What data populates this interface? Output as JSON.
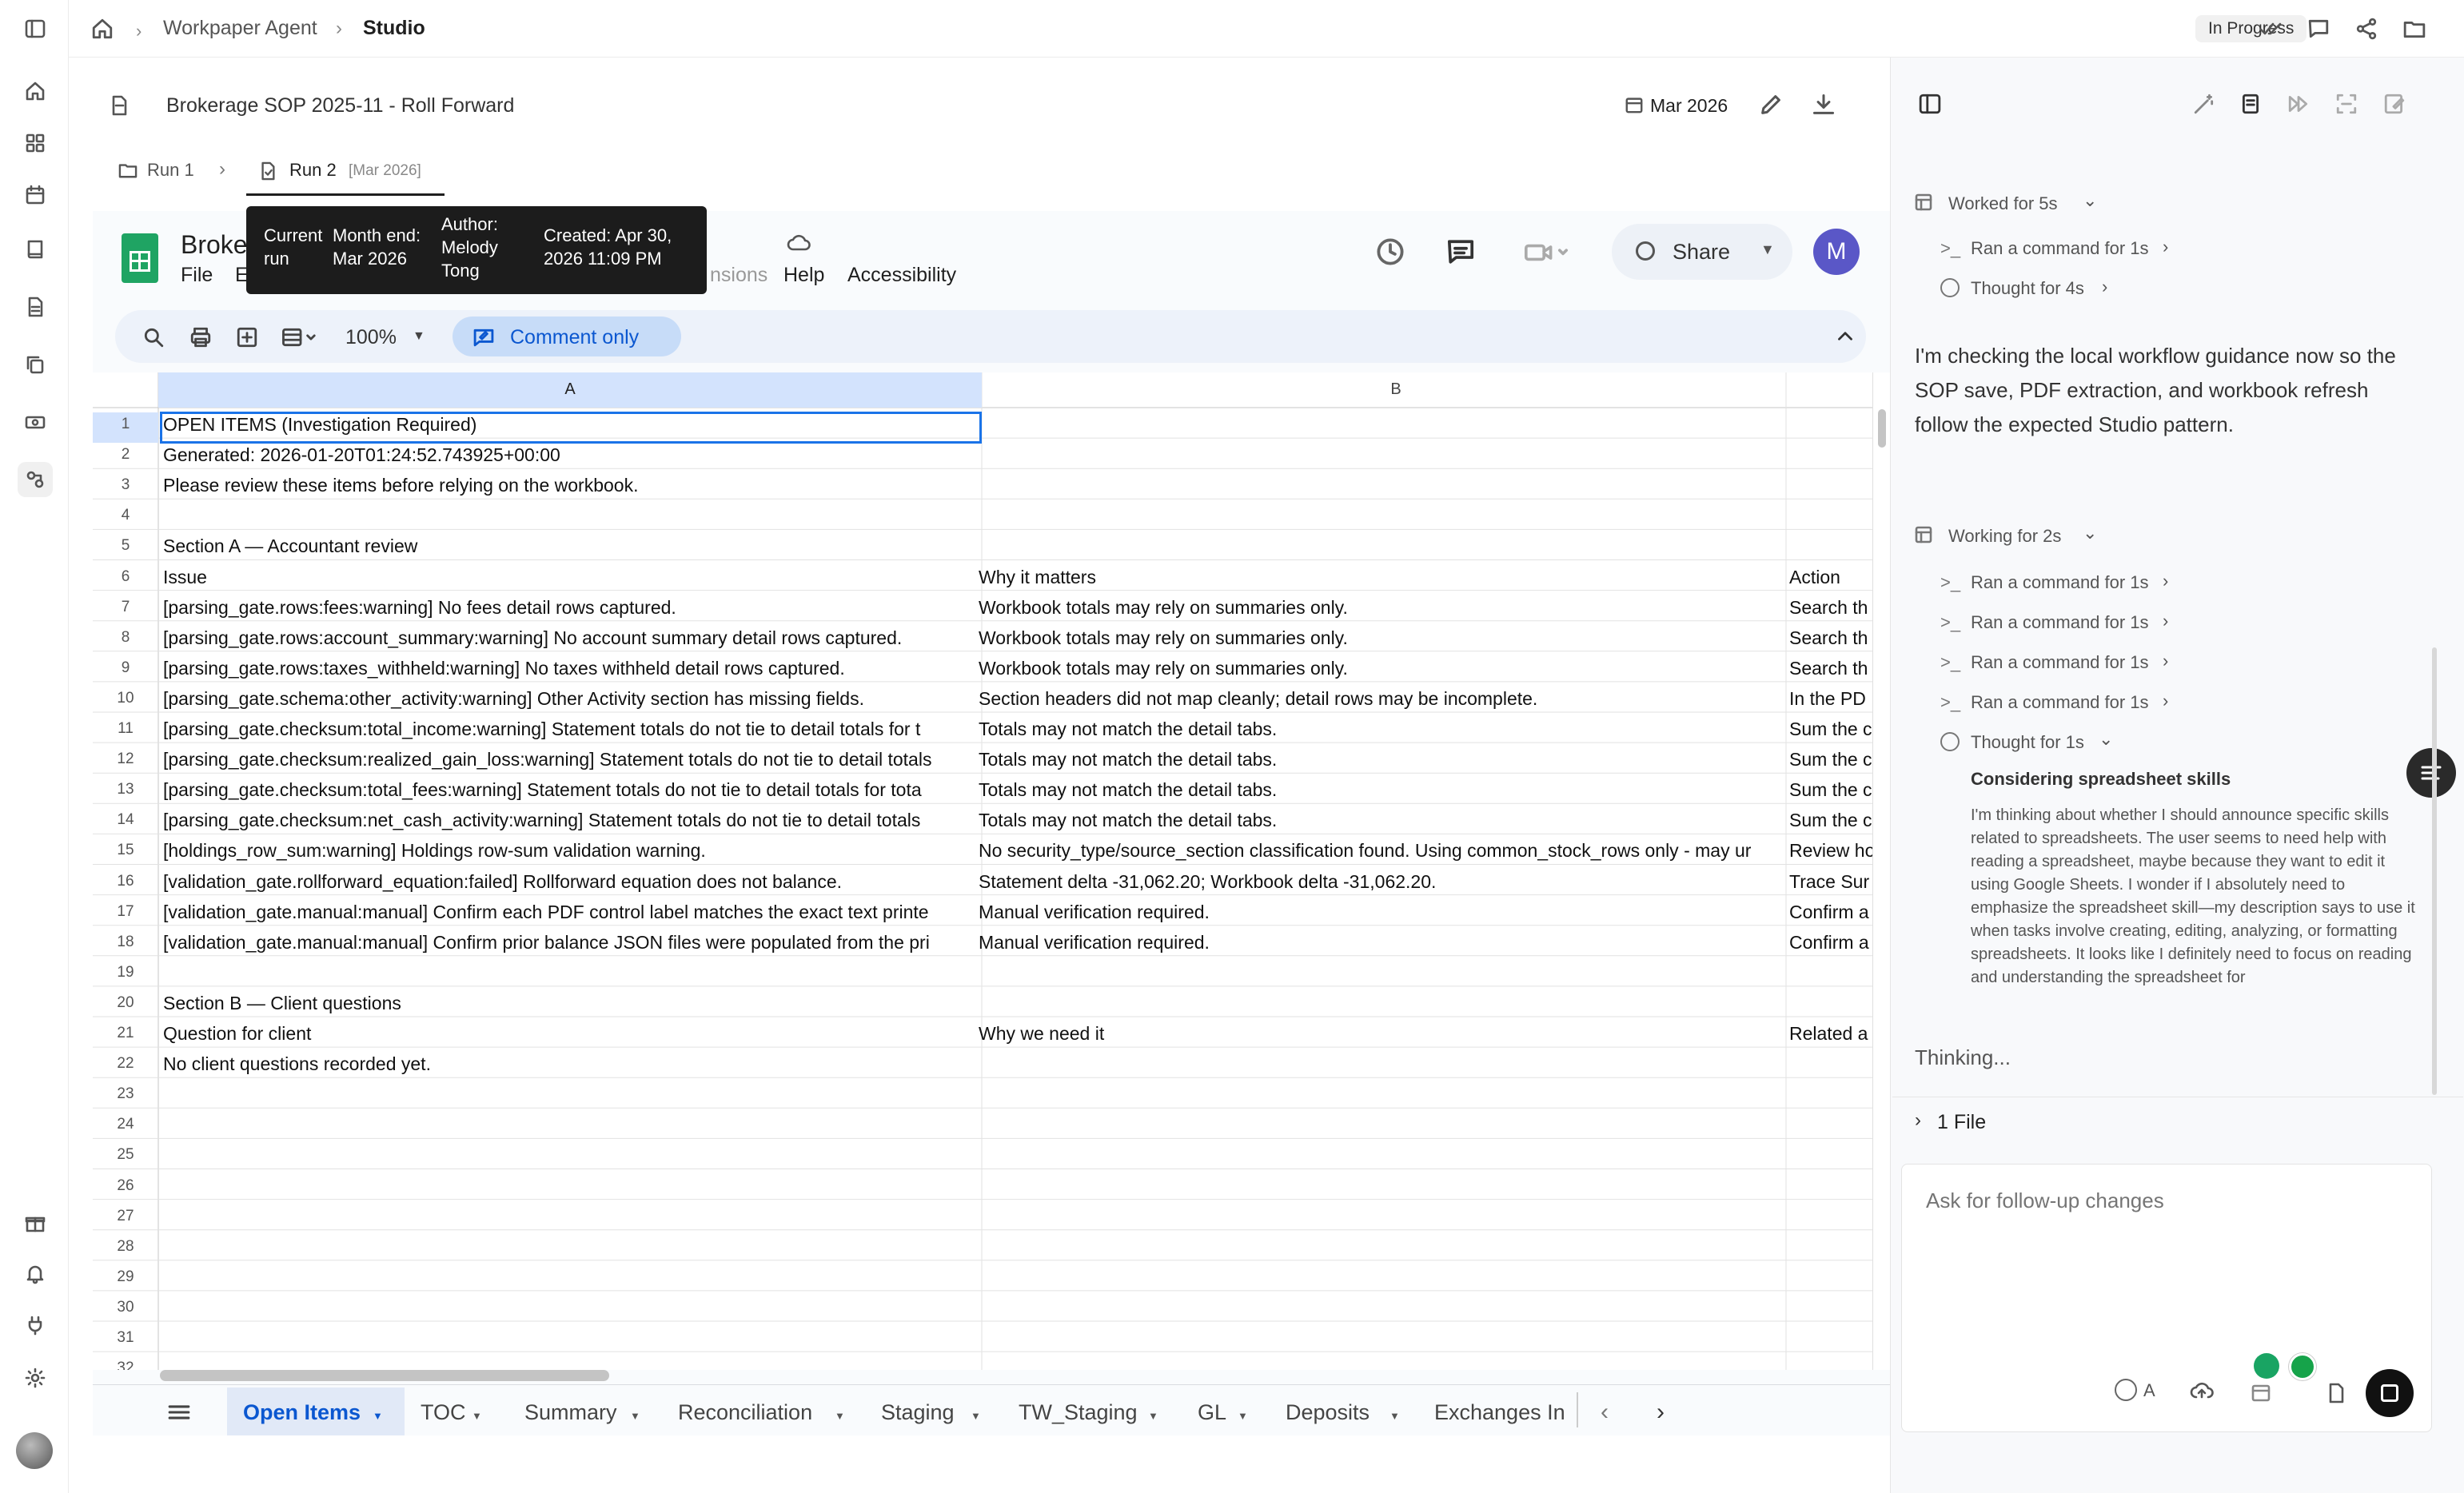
{
  "breadcrumb": {
    "agent": "Workpaper Agent",
    "current": "Studio"
  },
  "status_badge": "In Progress",
  "doc": {
    "title": "Brokerage SOP 2025-11 - Roll Forward",
    "date": "Mar 2026"
  },
  "runs": [
    {
      "label": "Run 1"
    },
    {
      "label": "Run 2",
      "tag": "[Mar 2026]"
    }
  ],
  "tooltip": {
    "c1": "Current\nrun",
    "c2": "Month end:\nMar 2026",
    "c3": "Author:\nMelody\nTong",
    "c4": "Created: Apr 30,\n2026 11:09 PM"
  },
  "sheets_app": {
    "title_fragment": "Broke",
    "menu": [
      "File",
      "E",
      "nsions",
      "Help",
      "Accessibility"
    ],
    "share_label": "Share",
    "avatar_letter": "M",
    "zoom": "100%",
    "comment_only": "Comment only",
    "columns": [
      "A",
      "B"
    ],
    "rows": [
      {
        "n": "1",
        "a": "OPEN ITEMS (Investigation Required)",
        "b": "",
        "c": ""
      },
      {
        "n": "2",
        "a": "Generated: 2026-01-20T01:24:52.743925+00:00",
        "b": "",
        "c": ""
      },
      {
        "n": "3",
        "a": "Please review these items before relying on the workbook.",
        "b": "",
        "c": ""
      },
      {
        "n": "4",
        "a": "",
        "b": "",
        "c": ""
      },
      {
        "n": "5",
        "a": "Section A — Accountant review",
        "b": "",
        "c": ""
      },
      {
        "n": "6",
        "a": "Issue",
        "b": "Why it matters",
        "c": "Action"
      },
      {
        "n": "7",
        "a": "[parsing_gate.rows:fees:warning] No fees detail rows captured.",
        "b": "Workbook totals may rely on summaries only.",
        "c": "Search th"
      },
      {
        "n": "8",
        "a": "[parsing_gate.rows:account_summary:warning] No account summary detail rows captured.",
        "b": "Workbook totals may rely on summaries only.",
        "c": "Search th"
      },
      {
        "n": "9",
        "a": "[parsing_gate.rows:taxes_withheld:warning] No taxes withheld detail rows captured.",
        "b": "Workbook totals may rely on summaries only.",
        "c": "Search th"
      },
      {
        "n": "10",
        "a": "[parsing_gate.schema:other_activity:warning] Other Activity section has missing fields.",
        "b": "Section headers did not map cleanly; detail rows may be incomplete.",
        "c": "In the PD"
      },
      {
        "n": "11",
        "a": "[parsing_gate.checksum:total_income:warning] Statement totals do not tie to detail totals for t",
        "b": "Totals may not match the detail tabs.",
        "c": "Sum the c"
      },
      {
        "n": "12",
        "a": "[parsing_gate.checksum:realized_gain_loss:warning] Statement totals do not tie to detail totals",
        "b": "Totals may not match the detail tabs.",
        "c": "Sum the c"
      },
      {
        "n": "13",
        "a": "[parsing_gate.checksum:total_fees:warning] Statement totals do not tie to detail totals for tota",
        "b": "Totals may not match the detail tabs.",
        "c": "Sum the c"
      },
      {
        "n": "14",
        "a": "[parsing_gate.checksum:net_cash_activity:warning] Statement totals do not tie to detail totals",
        "b": "Totals may not match the detail tabs.",
        "c": "Sum the c"
      },
      {
        "n": "15",
        "a": "[holdings_row_sum:warning] Holdings row-sum validation warning.",
        "b": "No security_type/source_section classification found. Using common_stock_rows only - may ur",
        "c": "Review ho"
      },
      {
        "n": "16",
        "a": "[validation_gate.rollforward_equation:failed] Rollforward equation does not balance.",
        "b": "Statement delta -31,062.20; Workbook delta -31,062.20.",
        "c": "Trace Sur"
      },
      {
        "n": "17",
        "a": "[validation_gate.manual:manual] Confirm each PDF control label matches the exact text printe",
        "b": "Manual verification required.",
        "c": "Confirm a"
      },
      {
        "n": "18",
        "a": "[validation_gate.manual:manual] Confirm prior balance JSON files were populated from the pri",
        "b": "Manual verification required.",
        "c": "Confirm a"
      },
      {
        "n": "19",
        "a": "",
        "b": "",
        "c": ""
      },
      {
        "n": "20",
        "a": "Section B — Client questions",
        "b": "",
        "c": ""
      },
      {
        "n": "21",
        "a": "Question for client",
        "b": "Why we need it",
        "c": "Related a"
      },
      {
        "n": "22",
        "a": "No client questions recorded yet.",
        "b": "",
        "c": ""
      },
      {
        "n": "23",
        "a": "",
        "b": "",
        "c": ""
      },
      {
        "n": "24",
        "a": "",
        "b": "",
        "c": ""
      },
      {
        "n": "25",
        "a": "",
        "b": "",
        "c": ""
      },
      {
        "n": "26",
        "a": "",
        "b": "",
        "c": ""
      },
      {
        "n": "27",
        "a": "",
        "b": "",
        "c": ""
      },
      {
        "n": "28",
        "a": "",
        "b": "",
        "c": ""
      },
      {
        "n": "29",
        "a": "",
        "b": "",
        "c": ""
      },
      {
        "n": "30",
        "a": "",
        "b": "",
        "c": ""
      },
      {
        "n": "31",
        "a": "",
        "b": "",
        "c": ""
      },
      {
        "n": "32",
        "a": "",
        "b": "",
        "c": ""
      }
    ],
    "tabs": [
      "Open Items",
      "TOC",
      "Summary",
      "Reconciliation",
      "Staging",
      "TW_Staging",
      "GL",
      "Deposits",
      "Exchanges In"
    ]
  },
  "agent_panel": {
    "worked_label": "Worked for 5s",
    "step1": "Ran a command for 1s",
    "thought1": "Thought for 4s",
    "message": "I'm checking the local workflow guidance now so the SOP save, PDF extraction, and workbook refresh follow the expected Studio pattern.",
    "working_label": "Working for 2s",
    "steps": [
      "Ran a command for 1s",
      "Ran a command for 1s",
      "Ran a command for 1s",
      "Ran a command for 1s"
    ],
    "thought2": "Thought for 1s",
    "thought_title": "Considering spreadsheet skills",
    "thought_body": "I'm thinking about whether I should announce specific skills related to spreadsheets. The user seems to need help with reading a spreadsheet, maybe because they want to edit it using Google Sheets. I wonder if I absolutely need to emphasize the spreadsheet skill—my description says to use it when tasks involve creating, editing, analyzing, or formatting spreadsheets. It looks like I definitely need to focus on reading and understanding the spreadsheet for",
    "thinking": "Thinking...",
    "files": "1 File",
    "input_placeholder": "Ask for follow-up changes",
    "model_letter": "A"
  }
}
